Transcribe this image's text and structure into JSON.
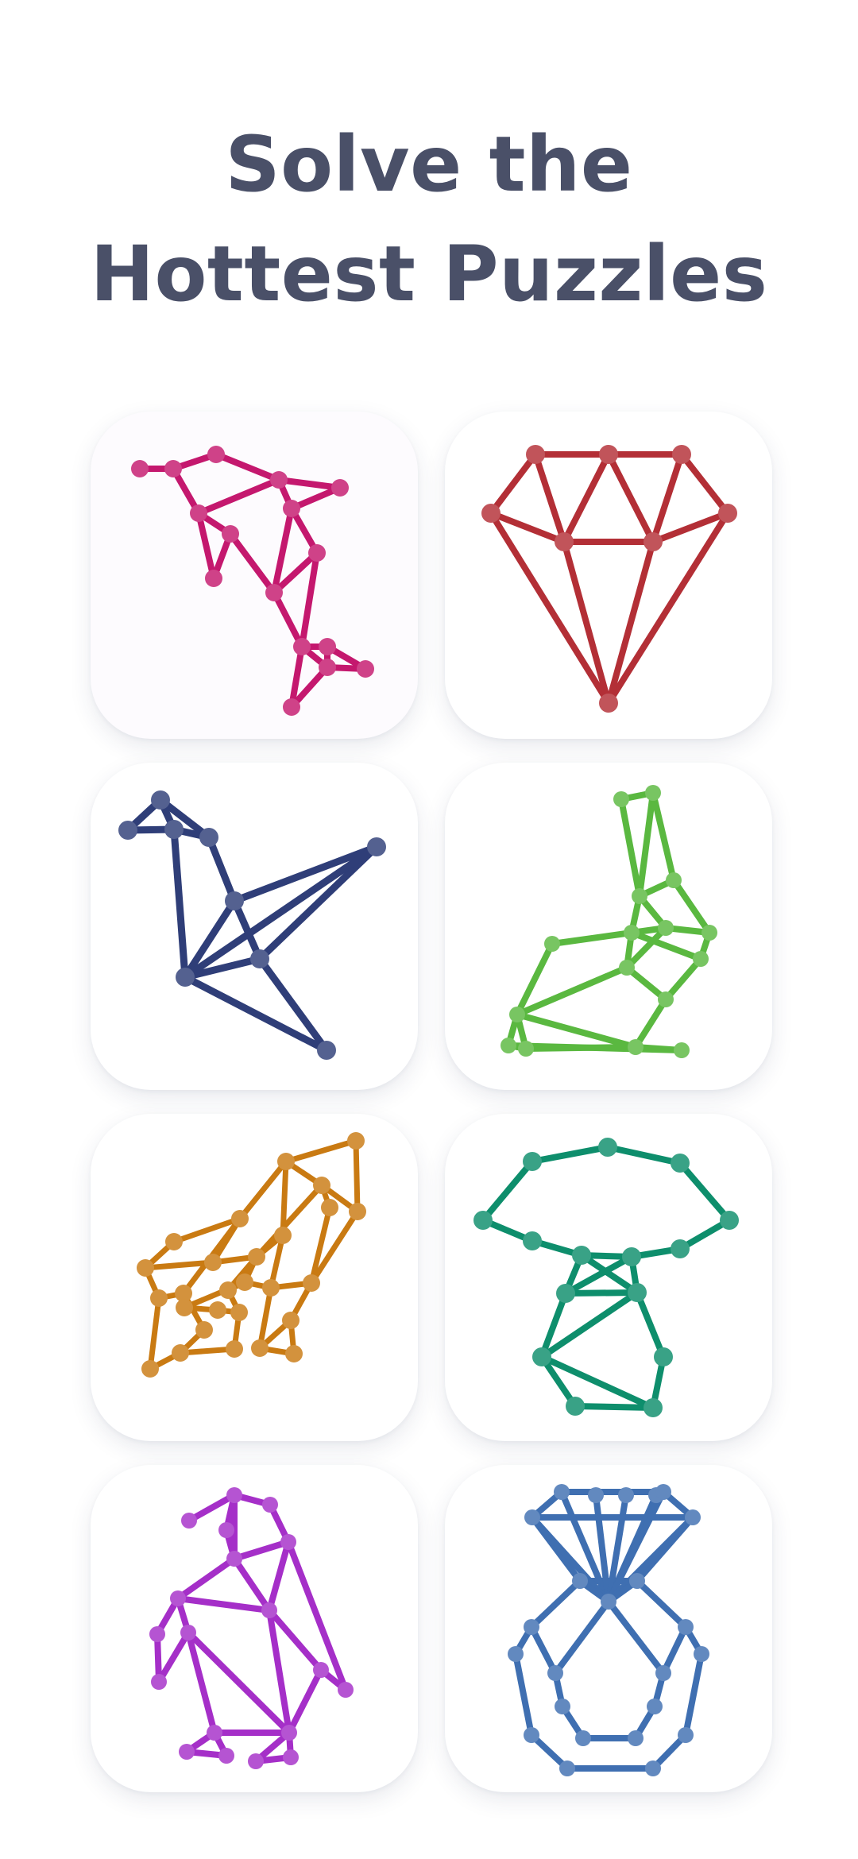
{
  "headline": {
    "line1": "Solve the",
    "line2": "Hottest Puzzles"
  },
  "puzzles": [
    {
      "name": "dolphin",
      "color": "#c4186e"
    },
    {
      "name": "diamond",
      "color": "#b32f36"
    },
    {
      "name": "crane",
      "color": "#2f3e78"
    },
    {
      "name": "rabbit",
      "color": "#5ab840"
    },
    {
      "name": "hand",
      "color": "#c97a12"
    },
    {
      "name": "mushroom",
      "color": "#0e8e6c"
    },
    {
      "name": "penguin",
      "color": "#a52fc8"
    },
    {
      "name": "ring",
      "color": "#3f6fb1"
    }
  ]
}
